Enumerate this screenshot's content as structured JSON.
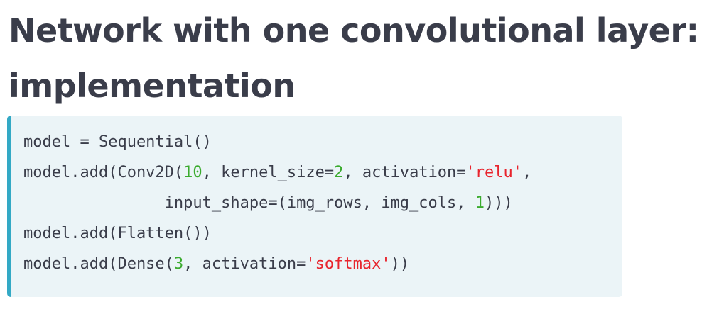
{
  "title": {
    "line1": "Network with one convolutional layer:",
    "line2": "implementation"
  },
  "code": {
    "line1": {
      "text": "model = Sequential()"
    },
    "line2": {
      "a": "model.add(Conv2D(",
      "num1": "10",
      "b": ", kernel_size=",
      "num2": "2",
      "c": ", activation=",
      "str1": "'relu'",
      "d": ","
    },
    "line3": {
      "a": "               input_shape=(img_rows, img_cols, ",
      "num1": "1",
      "b": ")))"
    },
    "line4": {
      "text": "model.add(Flatten())"
    },
    "line5": {
      "a": "model.add(Dense(",
      "num1": "3",
      "b": ", activation=",
      "str1": "'softmax'",
      "c": "))"
    }
  },
  "colors": {
    "title": "#3a3d4a",
    "code_background": "#ebf4f7",
    "code_accent_border": "#33a9c5",
    "code_text": "#3a3d4a",
    "number": "#3bab2f",
    "string": "#e8242d"
  }
}
